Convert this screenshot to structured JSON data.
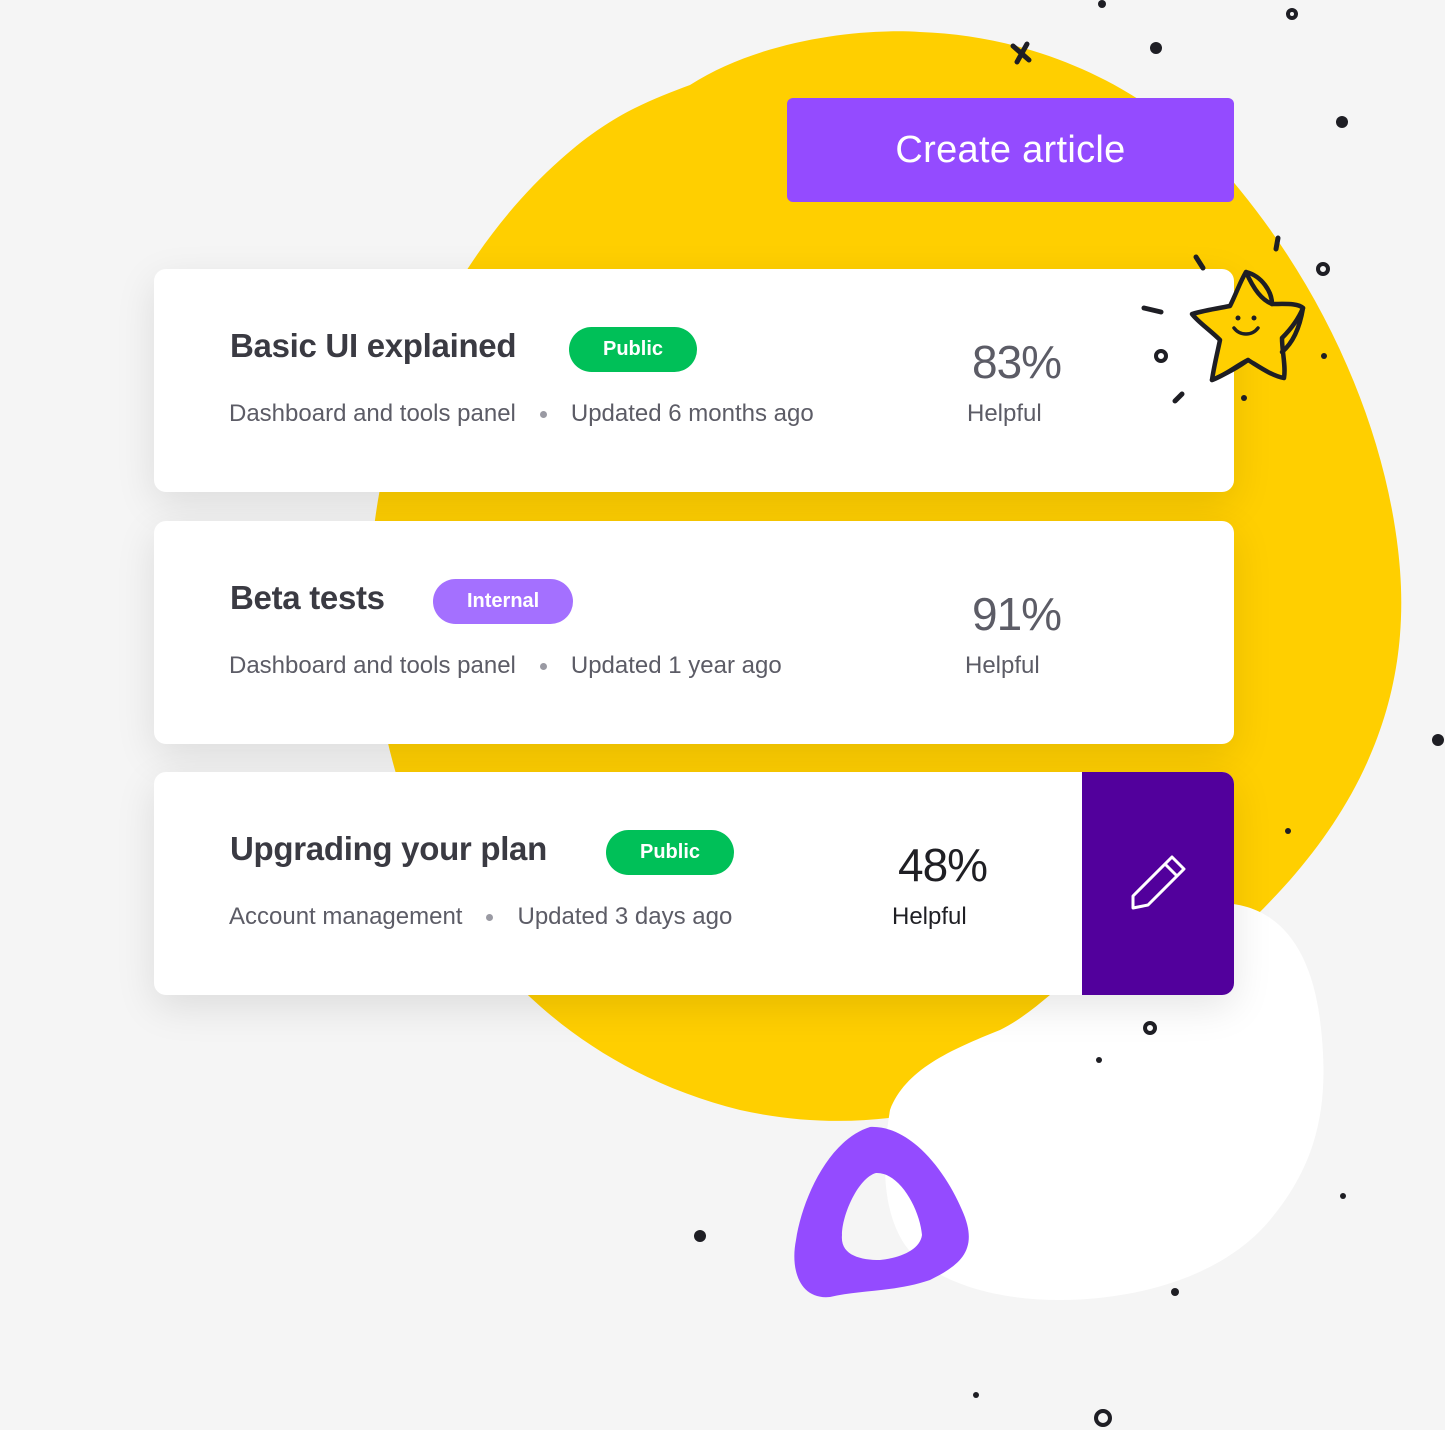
{
  "header": {
    "create_button_label": "Create article"
  },
  "colors": {
    "primary": "#944bff",
    "edit_panel": "#52009c",
    "badge_public": "#00c058",
    "badge_internal": "#a470ff",
    "blob_yellow": "#ffcf00",
    "background": "#f5f5f5"
  },
  "articles": [
    {
      "title": "Basic UI explained",
      "badge": "Public",
      "category": "Dashboard and tools panel",
      "updated": "Updated 6 months ago",
      "helpful_percent": "83%",
      "helpful_label": "Helpful"
    },
    {
      "title": "Beta tests",
      "badge": "Internal",
      "category": "Dashboard and tools panel",
      "updated": "Updated 1 year ago",
      "helpful_percent": "91%",
      "helpful_label": "Helpful"
    },
    {
      "title": "Upgrading your plan",
      "badge": "Public",
      "category": "Account management",
      "updated": "Updated 3 days ago",
      "helpful_percent": "48%",
      "helpful_label": "Helpful",
      "action_icon": "pencil-icon"
    }
  ],
  "decorations": {
    "mascot": "smiling-star-icon"
  }
}
